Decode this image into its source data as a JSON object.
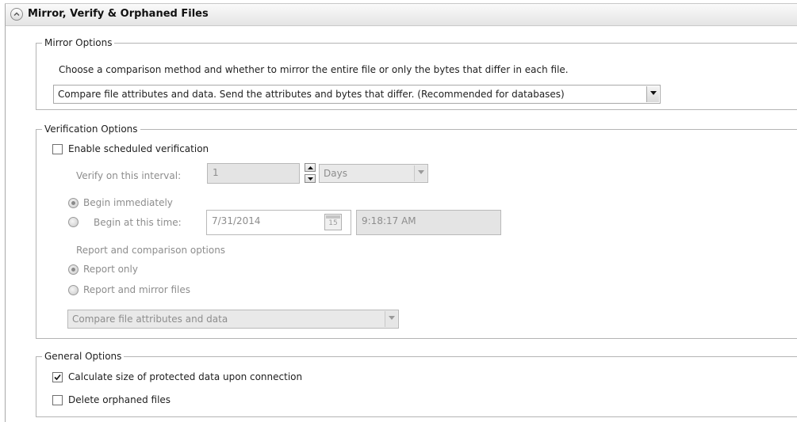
{
  "header": {
    "title": "Mirror, Verify & Orphaned Files"
  },
  "mirror_options": {
    "legend": "Mirror Options",
    "description": "Choose a comparison method and whether to mirror the entire file or only the bytes that differ in each file.",
    "method_selected": "Compare file attributes and data. Send the attributes and bytes that differ. (Recommended for databases)"
  },
  "verification_options": {
    "legend": "Verification Options",
    "enable_label": "Enable scheduled verification",
    "enable_checked": false,
    "interval_label": "Verify on this interval:",
    "interval_value": "1",
    "interval_unit": "Days",
    "begin_immediately_label": "Begin immediately",
    "begin_at_label": "Begin at this time:",
    "begin_date": "7/31/2014",
    "calendar_day": "15",
    "begin_time": "9:18:17 AM",
    "report_heading": "Report and comparison options",
    "report_only_label": "Report only",
    "report_mirror_label": "Report and mirror files",
    "compare_selected": "Compare file attributes and data"
  },
  "general_options": {
    "legend": "General Options",
    "calc_size_label": "Calculate size of protected data upon connection",
    "calc_size_checked": true,
    "delete_orphaned_label": "Delete orphaned files",
    "delete_orphaned_checked": false
  }
}
